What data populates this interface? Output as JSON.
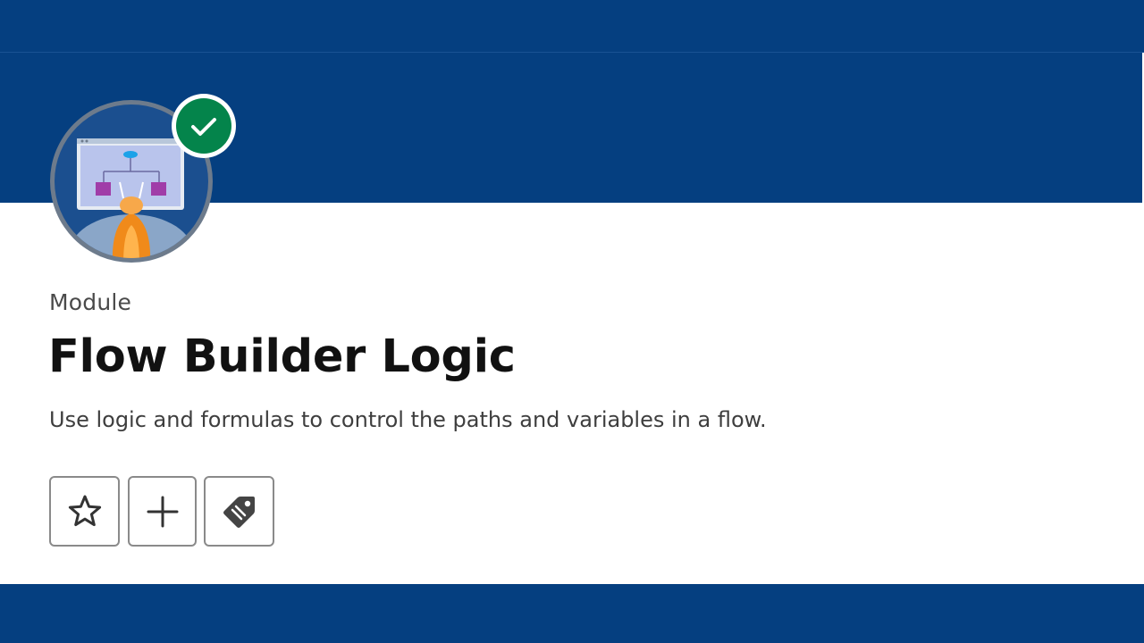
{
  "module": {
    "eyebrow": "Module",
    "title": "Flow Builder Logic",
    "description": "Use logic and formulas to control the paths and variables in a flow.",
    "completed": true
  },
  "actions": [
    {
      "icon": "star-icon",
      "name": "favorite"
    },
    {
      "icon": "plus-icon",
      "name": "add-to-list"
    },
    {
      "icon": "tag-icon",
      "name": "tag"
    }
  ],
  "colors": {
    "brand_navy": "#053F80",
    "success_green": "#04844B",
    "text_dark": "#111111",
    "text_muted": "#4a4a4a"
  }
}
